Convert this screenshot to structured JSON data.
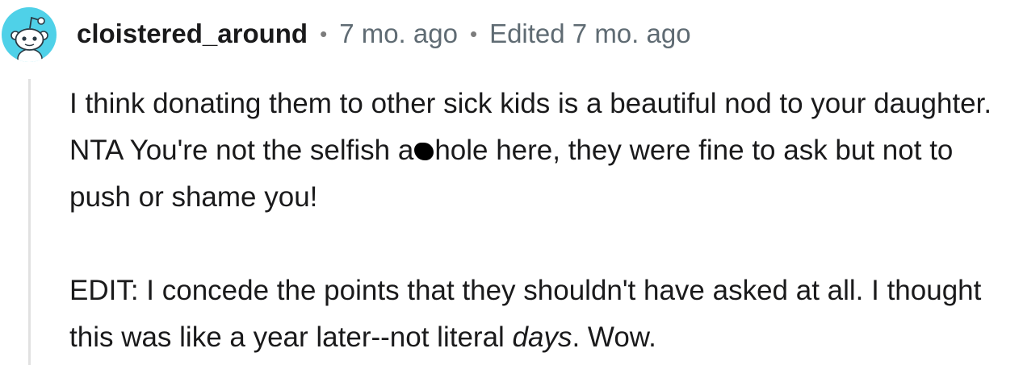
{
  "comment": {
    "username": "cloistered_around",
    "separator": "•",
    "posted": "7 mo. ago",
    "edited": "Edited 7 mo. ago",
    "paragraph1": {
      "before_redaction": "I think donating them to other sick kids is a beautiful nod to your daughter. NTA You're not the selfish a",
      "after_redaction": "hole here, they were fine to ask but not to push or shame you!"
    },
    "paragraph2": {
      "before_emphasis": "EDIT: I concede the points that they shouldn't have asked at all. I thought this was like a year later--not literal ",
      "emphasis": "days",
      "after_emphasis": ". Wow."
    }
  },
  "icons": {
    "avatar": "reddit-snoo-avatar-icon",
    "redaction": "black-scribble-redaction"
  },
  "colors": {
    "avatar_bg": "#4fd1e8",
    "username": "#1a1a1b",
    "meta": "#5f6b73",
    "thread_line": "#e1e1e1"
  }
}
